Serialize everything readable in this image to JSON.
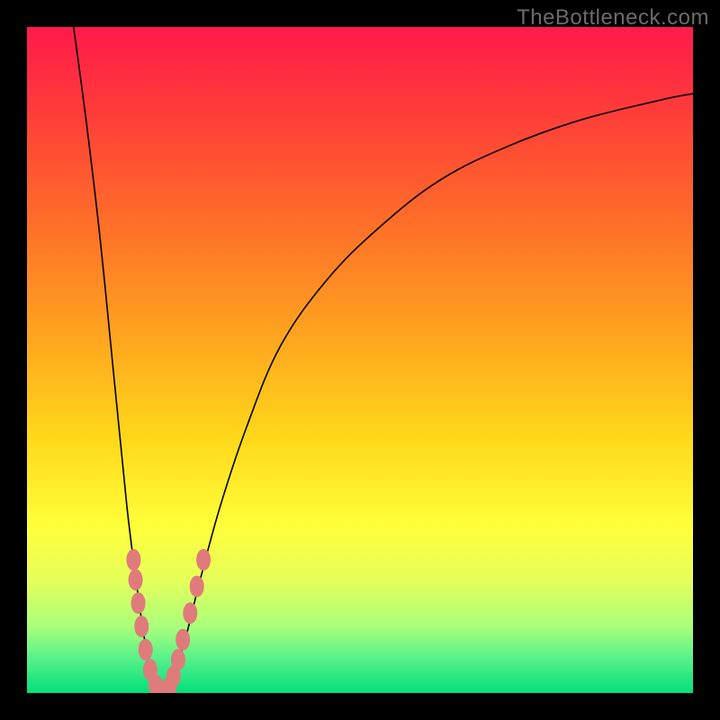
{
  "watermark": "TheBottleneck.com",
  "colors": {
    "frame": "#000000",
    "gradient_top": "#ff1a4b",
    "gradient_bottom": "#00e07a",
    "curve": "#000000",
    "dots": "#e07b7b"
  },
  "chart_data": {
    "type": "line",
    "title": "",
    "xlabel": "",
    "ylabel": "",
    "xlim": [
      0,
      100
    ],
    "ylim": [
      0,
      100
    ],
    "series": [
      {
        "name": "left-branch",
        "x": [
          7,
          9,
          11,
          13,
          15,
          16.5,
          17.5,
          18.3,
          19,
          19.5,
          20
        ],
        "y": [
          100,
          85,
          68,
          48,
          28,
          16,
          9,
          4.5,
          2,
          0.8,
          0
        ]
      },
      {
        "name": "right-branch",
        "x": [
          20,
          21,
          22.5,
          24,
          26,
          29,
          33,
          38,
          45,
          53,
          62,
          72,
          83,
          95,
          100
        ],
        "y": [
          0,
          1.2,
          4,
          9,
          17,
          28,
          40,
          52,
          62,
          70,
          77,
          82,
          86,
          89,
          90
        ]
      }
    ],
    "dot_clusters": [
      {
        "name": "left-cluster",
        "points": [
          {
            "x": 16.0,
            "y": 20
          },
          {
            "x": 16.3,
            "y": 17
          },
          {
            "x": 16.7,
            "y": 13.5
          },
          {
            "x": 17.2,
            "y": 10
          },
          {
            "x": 17.8,
            "y": 6.5
          },
          {
            "x": 18.5,
            "y": 3.5
          },
          {
            "x": 19.3,
            "y": 1.2
          }
        ]
      },
      {
        "name": "bottom-cluster",
        "points": [
          {
            "x": 20.0,
            "y": 0.2
          },
          {
            "x": 20.7,
            "y": 0.3
          },
          {
            "x": 21.4,
            "y": 0.9
          }
        ]
      },
      {
        "name": "right-cluster",
        "points": [
          {
            "x": 22.0,
            "y": 2.5
          },
          {
            "x": 22.7,
            "y": 5
          },
          {
            "x": 23.4,
            "y": 8
          },
          {
            "x": 24.5,
            "y": 12
          },
          {
            "x": 25.5,
            "y": 16
          },
          {
            "x": 26.5,
            "y": 20
          }
        ]
      }
    ]
  }
}
